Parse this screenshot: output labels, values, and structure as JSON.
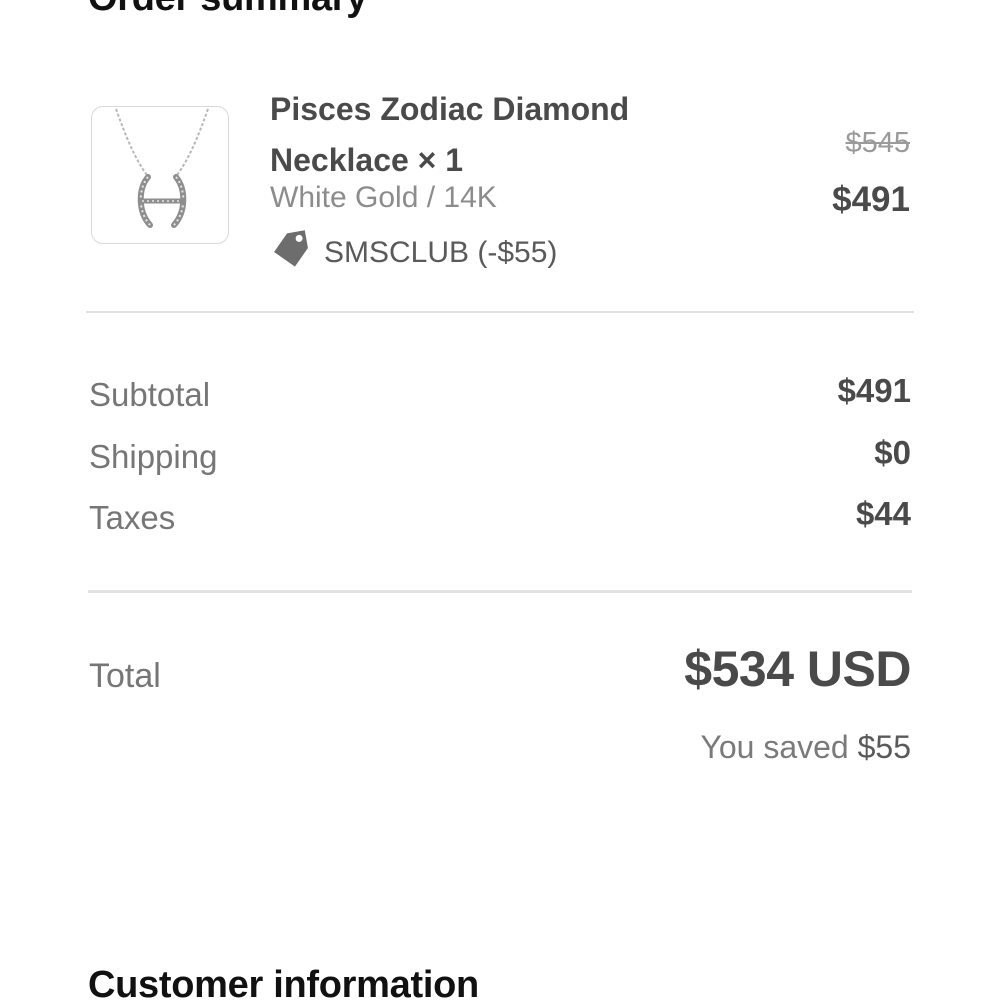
{
  "order_summary": {
    "title": "Order summary",
    "item": {
      "name": "Pisces Zodiac Diamond Necklace × 1",
      "variant": "White Gold / 14K",
      "discount_code": "SMSCLUB (-$55)",
      "original_price": "$545",
      "price": "$491",
      "thumbnail_icon": "necklace-image",
      "discount_icon": "tag-icon"
    },
    "rows": {
      "subtotal_label": "Subtotal",
      "subtotal_value": "$491",
      "shipping_label": "Shipping",
      "shipping_value": "$0",
      "taxes_label": "Taxes",
      "taxes_value": "$44"
    },
    "total": {
      "label": "Total",
      "value": "$534 USD",
      "saved_prefix": "You saved",
      "saved_amount": "$55"
    }
  },
  "customer_information": {
    "title": "Customer information"
  },
  "colors": {
    "heading": "#111111",
    "text_dark": "#4a4a4a",
    "text_muted": "#767676",
    "divider": "#e2e2e2"
  }
}
